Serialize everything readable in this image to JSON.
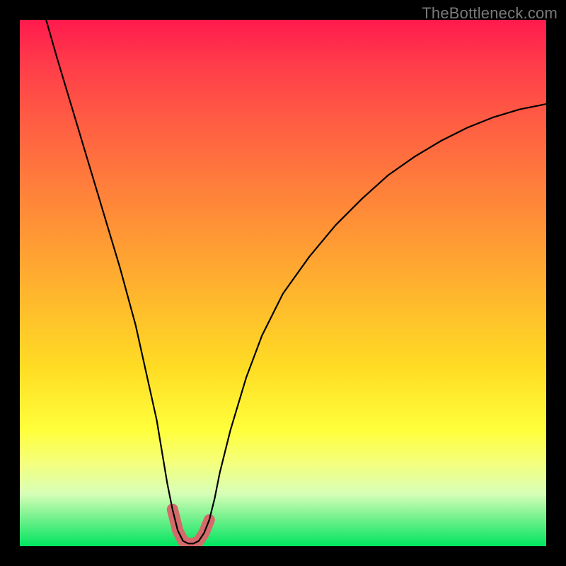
{
  "attribution": "TheBottleneck.com",
  "chart_data": {
    "type": "line",
    "title": "",
    "xlabel": "",
    "ylabel": "",
    "xlim": [
      0,
      100
    ],
    "ylim": [
      0,
      100
    ],
    "grid": false,
    "x": [
      5,
      7,
      10,
      13,
      16,
      19,
      22,
      24,
      26,
      27,
      28,
      29,
      30,
      31,
      32,
      33,
      34,
      35,
      36,
      37,
      38,
      40,
      43,
      46,
      50,
      55,
      60,
      65,
      70,
      75,
      80,
      85,
      90,
      95,
      100
    ],
    "values": [
      100,
      93,
      83,
      73,
      63,
      53,
      42,
      33,
      24,
      18,
      12,
      7,
      3,
      1,
      0.5,
      0.5,
      1,
      2.5,
      5,
      9,
      14,
      22,
      32,
      40,
      48,
      55,
      61,
      66,
      70.5,
      74,
      77,
      79.5,
      81.5,
      83,
      84
    ],
    "highlight": {
      "color": "#d46a6a",
      "stroke_width": 16,
      "x": [
        29,
        30,
        31,
        32,
        33,
        34,
        35,
        36
      ],
      "values": [
        7,
        3,
        1,
        0.5,
        0.5,
        1,
        2.5,
        5
      ]
    },
    "background_gradient": {
      "direction": "vertical",
      "stops": [
        {
          "pos": 0.0,
          "color": "#ff1a4d"
        },
        {
          "pos": 0.5,
          "color": "#ffbb2c"
        },
        {
          "pos": 0.78,
          "color": "#ffff3c"
        },
        {
          "pos": 1.0,
          "color": "#00e560"
        }
      ]
    }
  }
}
